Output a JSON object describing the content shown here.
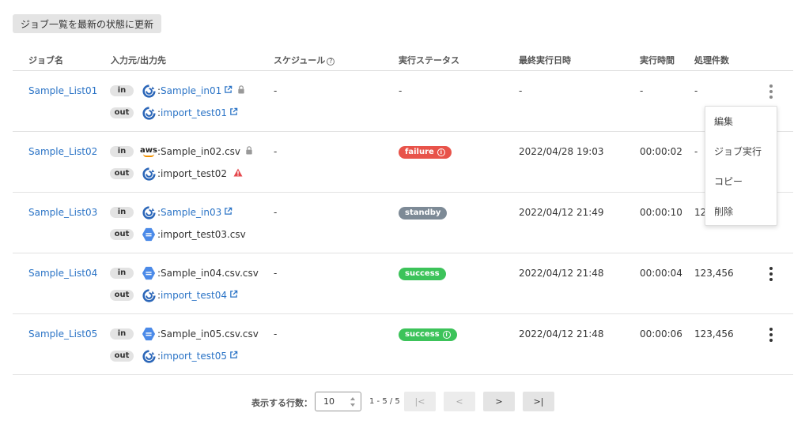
{
  "refresh_button": "ジョブ一覧を最新の状態に更新",
  "headers": {
    "job_name": "ジョブ名",
    "io": "入力元/出力先",
    "schedule": "スケジュール",
    "status": "実行ステータス",
    "last_run": "最終実行日時",
    "duration": "実行時間",
    "count": "処理件数"
  },
  "io_labels": {
    "in": "in",
    "out": "out"
  },
  "rows": [
    {
      "name": "Sample_List01",
      "in": {
        "prefix": ": ",
        "name": "Sample_in01",
        "icon": "sync-icon"
      },
      "out": {
        "prefix": ": ",
        "name": "import_test01",
        "icon": "sync-icon"
      },
      "schedule": "-",
      "status": "-",
      "last_run": "-",
      "duration": "-",
      "count": "-"
    },
    {
      "name": "Sample_List02",
      "in": {
        "prefix": ": ",
        "name": "Sample_in02.csv",
        "icon": "aws-icon",
        "aws_text": "aws"
      },
      "out": {
        "prefix": ": ",
        "name": "import_test02",
        "icon": "sync-icon"
      },
      "schedule": "-",
      "status": "failure",
      "last_run": "2022/04/28 19:03",
      "duration": "00:00:02",
      "count": "-"
    },
    {
      "name": "Sample_List03",
      "in": {
        "prefix": ": ",
        "name": "Sample_in03",
        "icon": "sync-icon"
      },
      "out": {
        "prefix": ": ",
        "name": "import_test03.csv",
        "icon": "file-icon"
      },
      "schedule": "-",
      "status": "standby",
      "last_run": "2022/04/12 21:49",
      "duration": "00:00:10",
      "count": "12"
    },
    {
      "name": "Sample_List04",
      "in": {
        "prefix": ": ",
        "name": "Sample_in04.csv.csv",
        "icon": "file-icon"
      },
      "out": {
        "prefix": ": ",
        "name": "import_test04",
        "icon": "sync-icon"
      },
      "schedule": "-",
      "status": "success",
      "last_run": "2022/04/12 21:48",
      "duration": "00:00:04",
      "count": "123,456"
    },
    {
      "name": "Sample_List05",
      "in": {
        "prefix": ": ",
        "name": "Sample_in05.csv.csv",
        "icon": "file-icon"
      },
      "out": {
        "prefix": ": ",
        "name": "import_test05",
        "icon": "sync-icon"
      },
      "schedule": "-",
      "status": "success",
      "last_run": "2022/04/12 21:48",
      "duration": "00:00:06",
      "count": "123,456"
    }
  ],
  "status_colors": {
    "failure": "#e8534a",
    "standby": "#7d8a96",
    "success": "#3cc35a"
  },
  "context_menu": [
    "編集",
    "ジョブ実行",
    "コピー",
    "削除"
  ],
  "pagination": {
    "rows_label": "表示する行数：",
    "rows_value": "10",
    "range": "1 - 5 / 5",
    "first": "|<",
    "prev": "<",
    "next": ">",
    "last": ">|"
  }
}
